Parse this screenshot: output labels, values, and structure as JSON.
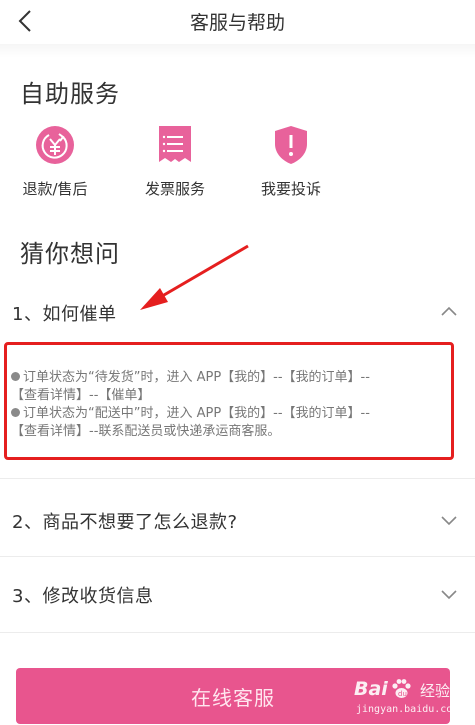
{
  "header": {
    "title": "客服与帮助"
  },
  "self_service": {
    "title": "自助服务",
    "items": [
      {
        "label": "退款/售后",
        "icon": "refund-yen-icon"
      },
      {
        "label": "发票服务",
        "icon": "invoice-receipt-icon"
      },
      {
        "label": "我要投诉",
        "icon": "complaint-shield-icon"
      }
    ]
  },
  "guess": {
    "title": "猜你想问",
    "faqs": [
      {
        "question": "1、如何催单",
        "expanded": true,
        "answer": [
          "订单状态为“待发货”时，进入 APP【我的】--【我的订单】--",
          "【查看详情】--【催单】",
          "订单状态为“配送中”时，进入 APP【我的】--【我的订单】--",
          "【查看详情】--联系配送员或快递承运商客服。"
        ]
      },
      {
        "question": "2、商品不想要了怎么退款?",
        "expanded": false
      },
      {
        "question": "3、修改收货信息",
        "expanded": false
      }
    ]
  },
  "online_service_button": "在线客服",
  "colors": {
    "accent": "#e8558e",
    "annotation": "#e51f1f"
  },
  "watermark": {
    "logo": "Bai",
    "logo_suffix": "du",
    "cn": "经验",
    "url": "jingyan.baidu.com"
  }
}
